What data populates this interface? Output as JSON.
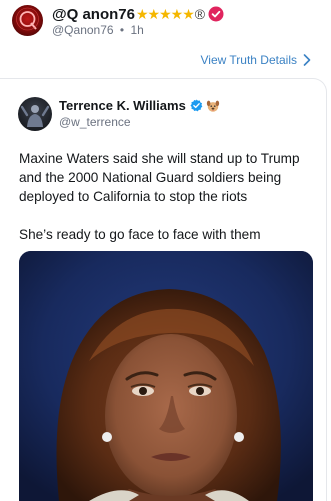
{
  "post": {
    "display_name": "@Q anon76",
    "stars": "★★★★★",
    "reg_mark": "®",
    "handle": "@Qanon76",
    "dot": "•",
    "time": "1h",
    "view_details_label": "View Truth Details"
  },
  "quoted": {
    "name": "Terrence K. Williams",
    "handle": "@w_terrence",
    "paragraph1": "Maxine Waters said she will stand up to Trump and the 2000 National Guard soldiers being deployed to California to stop the riots",
    "paragraph2": "She’s ready to go face to face with them"
  },
  "colors": {
    "link": "#3b82c4",
    "verified_pink": "#e0245e",
    "verified_blue": "#1d9bf0",
    "star": "#f5b700"
  },
  "icons": {
    "verified_pink": "verified-badge-icon",
    "verified_blue": "verified-badge-icon",
    "chevron": "chevron-right-icon",
    "emoji": "dog-face-emoji-icon"
  }
}
